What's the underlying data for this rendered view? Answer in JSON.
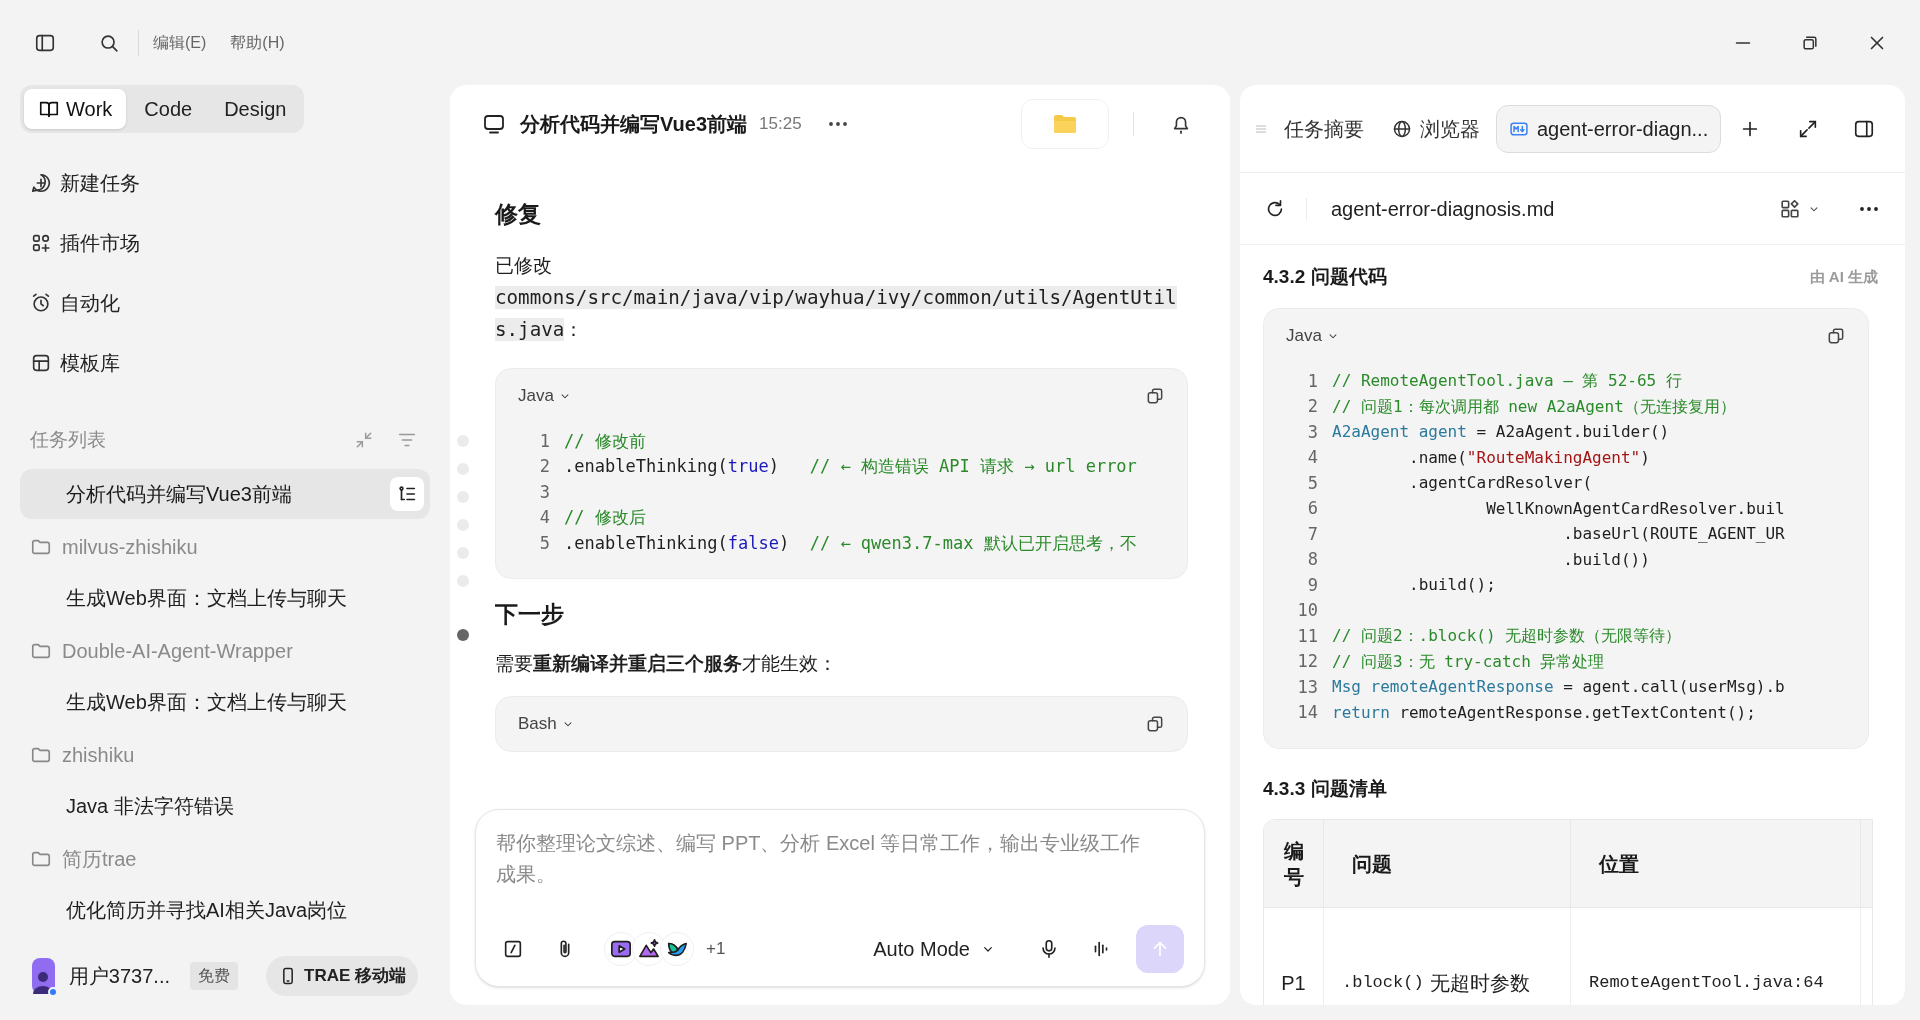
{
  "menu": [
    {
      "label": "编辑(E)"
    },
    {
      "label": "帮助(H)"
    }
  ],
  "modes": [
    {
      "label": "Work",
      "selected": true
    },
    {
      "label": "Code",
      "selected": false
    },
    {
      "label": "Design",
      "selected": false
    }
  ],
  "nav": [
    {
      "label": "新建任务"
    },
    {
      "label": "插件市场"
    },
    {
      "label": "自动化"
    },
    {
      "label": "模板库"
    }
  ],
  "task_list": {
    "title": "任务列表",
    "items": [
      {
        "kind": "task",
        "label": "分析代码并编写Vue3前端",
        "selected": true
      },
      {
        "kind": "folder",
        "label": "milvus-zhishiku",
        "children": [
          {
            "kind": "task",
            "label": "生成Web界面：文档上传与聊天",
            "selected": false
          }
        ]
      },
      {
        "kind": "folder",
        "label": "Double-AI-Agent-Wrapper",
        "children": [
          {
            "kind": "task",
            "label": "生成Web界面：文档上传与聊天",
            "selected": false
          }
        ]
      },
      {
        "kind": "folder",
        "label": "zhishiku",
        "children": [
          {
            "kind": "task",
            "label": "Java 非法字符错误",
            "selected": false
          }
        ]
      },
      {
        "kind": "folder",
        "label": "简历trae",
        "children": [
          {
            "kind": "task",
            "label": "优化简历并寻找AI相关Java岗位",
            "selected": false
          }
        ]
      }
    ]
  },
  "user": {
    "name": "用户3737...",
    "plan": "免费"
  },
  "mobile_button": "TRAE 移动端",
  "chat": {
    "title": "分析代码并编写Vue3前端",
    "time": "15:25",
    "outline_dots": [
      {
        "selected": false
      },
      {
        "selected": false
      },
      {
        "selected": false
      },
      {
        "selected": false
      },
      {
        "selected": false
      },
      {
        "selected": false
      },
      {
        "selected": true
      }
    ],
    "blocks": [
      {
        "kind": "heading",
        "text": "修复"
      },
      {
        "kind": "file_note",
        "text": "已修改",
        "path": "commons/src/main/java/vip/wayhua/ivy/common/utils/AgentUtils.java",
        "suffix": "："
      },
      {
        "kind": "code",
        "language": "Java",
        "lines": [
          {
            "number": "1",
            "tokens": [
              {
                "kind": "comment",
                "text": "// 修改前"
              }
            ]
          },
          {
            "number": "2",
            "tokens": [
              {
                "kind": "plain",
                "text": ".enableThinking("
              },
              {
                "kind": "keyword",
                "text": "true"
              },
              {
                "kind": "plain",
                "text": ")   "
              },
              {
                "kind": "comment",
                "text": "// ← 构造错误 API 请求 → url error"
              }
            ]
          },
          {
            "number": "3"
          },
          {
            "number": "4",
            "tokens": [
              {
                "kind": "comment",
                "text": "// 修改后"
              }
            ]
          },
          {
            "number": "5",
            "tokens": [
              {
                "kind": "plain",
                "text": ".enableThinking("
              },
              {
                "kind": "keyword",
                "text": "false"
              },
              {
                "kind": "plain",
                "text": ")  "
              },
              {
                "kind": "comment",
                "text": "// ← qwen3.7-max 默认已开启思考，不"
              }
            ]
          }
        ]
      },
      {
        "kind": "heading",
        "text": "下一步"
      },
      {
        "kind": "paragraph",
        "text": "需要**重新编译并重启三个服务**才能生效："
      },
      {
        "kind": "code",
        "language": "Bash"
      }
    ]
  },
  "composer": {
    "placeholder": "帮你整理论文综述、编写 PPT、分析 Excel 等日常工作，输出专业级工作成果。",
    "more_tools": "+1",
    "mode": "Auto Mode"
  },
  "viewer": {
    "tabs": [
      {
        "label": "任务摘要",
        "selected": false
      },
      {
        "label": "浏览器",
        "selected": false
      },
      {
        "label": "agent-error-diagn...",
        "selected": true
      }
    ],
    "file": "agent-error-diagnosis.md",
    "ai_label": "由 AI 生成",
    "blocks": [
      {
        "kind": "heading",
        "text": "4.3.2 问题代码"
      },
      {
        "kind": "code",
        "language": "Java",
        "lines": [
          {
            "number": "1",
            "tokens": [
              {
                "kind": "comment",
                "text": "// RemoteAgentTool.java — 第 52-65 行"
              }
            ]
          },
          {
            "number": "2",
            "tokens": [
              {
                "kind": "comment",
                "text": "// 问题1：每次调用都 new A2aAgent（无连接复用）"
              }
            ]
          },
          {
            "number": "3",
            "tokens": [
              {
                "kind": "type",
                "text": "A2aAgent agent"
              },
              {
                "kind": "plain",
                "text": " = A2aAgent.builder()"
              }
            ]
          },
          {
            "number": "4",
            "tokens": [
              {
                "kind": "plain",
                "text": "        .name("
              },
              {
                "kind": "string",
                "text": "\"RouteMakingAgent\""
              },
              {
                "kind": "plain",
                "text": ")"
              }
            ]
          },
          {
            "number": "5",
            "tokens": [
              {
                "kind": "plain",
                "text": "        .agentCardResolver("
              }
            ]
          },
          {
            "number": "6",
            "tokens": [
              {
                "kind": "plain",
                "text": "                WellKnownAgentCardResolver.buil"
              }
            ]
          },
          {
            "number": "7",
            "tokens": [
              {
                "kind": "plain",
                "text": "                        .baseUrl(ROUTE_AGENT_UR"
              }
            ]
          },
          {
            "number": "8",
            "tokens": [
              {
                "kind": "plain",
                "text": "                        .build())"
              }
            ]
          },
          {
            "number": "9",
            "tokens": [
              {
                "kind": "plain",
                "text": "        .build();"
              }
            ]
          },
          {
            "number": "10"
          },
          {
            "number": "11",
            "tokens": [
              {
                "kind": "comment",
                "text": "// 问题2：.block() 无超时参数（无限等待）"
              }
            ]
          },
          {
            "number": "12",
            "tokens": [
              {
                "kind": "comment",
                "text": "// 问题3：无 try-catch 异常处理"
              }
            ]
          },
          {
            "number": "13",
            "tokens": [
              {
                "kind": "type",
                "text": "Msg remoteAgentResponse"
              },
              {
                "kind": "plain",
                "text": " = agent.call(userMsg).b"
              }
            ]
          },
          {
            "number": "14",
            "tokens": [
              {
                "kind": "type",
                "text": "return"
              },
              {
                "kind": "plain",
                "text": " remoteAgentResponse.getTextContent();"
              }
            ]
          }
        ]
      },
      {
        "kind": "heading",
        "text": "4.3.3 问题清单"
      },
      {
        "kind": "table",
        "columns": [
          "编号",
          "问题",
          "位置"
        ],
        "rows": [
          {
            "cells": [
              {
                "kind": "text",
                "text": "P1"
              },
              {
                "kind": "mixed",
                "code": ".block()",
                "text": "无超时参数"
              },
              {
                "kind": "code",
                "text": "RemoteAgentTool.java:64"
              }
            ]
          }
        ]
      }
    ]
  }
}
